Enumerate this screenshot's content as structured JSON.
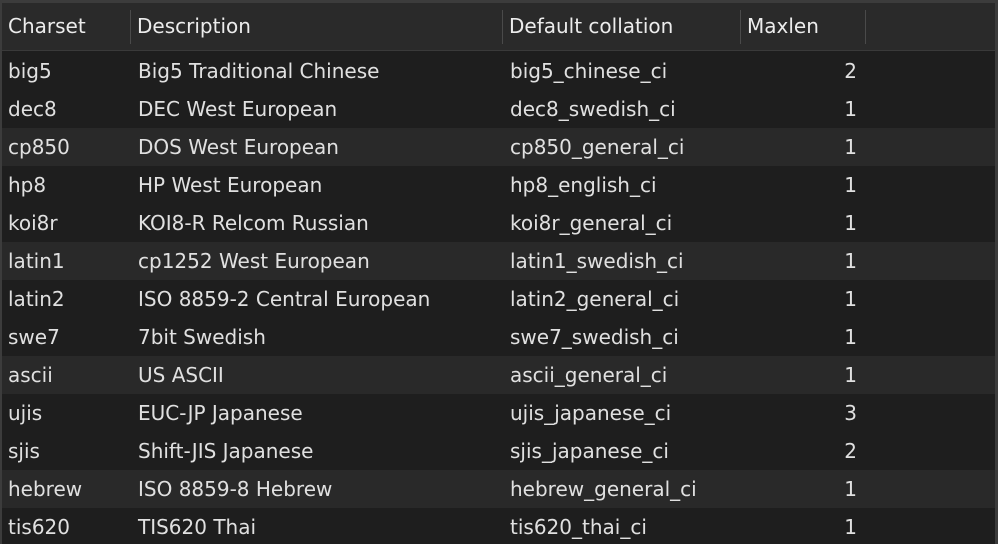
{
  "columns": {
    "charset": "Charset",
    "description": "Description",
    "default_collation": "Default collation",
    "maxlen": "Maxlen"
  },
  "rows": [
    {
      "charset": "big5",
      "description": "Big5 Traditional Chinese",
      "collation": "big5_chinese_ci",
      "maxlen": "2"
    },
    {
      "charset": "dec8",
      "description": "DEC West European",
      "collation": "dec8_swedish_ci",
      "maxlen": "1"
    },
    {
      "charset": "cp850",
      "description": "DOS West European",
      "collation": "cp850_general_ci",
      "maxlen": "1"
    },
    {
      "charset": "hp8",
      "description": "HP West European",
      "collation": "hp8_english_ci",
      "maxlen": "1"
    },
    {
      "charset": "koi8r",
      "description": "KOI8-R Relcom Russian",
      "collation": "koi8r_general_ci",
      "maxlen": "1"
    },
    {
      "charset": "latin1",
      "description": "cp1252 West European",
      "collation": "latin1_swedish_ci",
      "maxlen": "1"
    },
    {
      "charset": "latin2",
      "description": "ISO 8859-2 Central European",
      "collation": "latin2_general_ci",
      "maxlen": "1"
    },
    {
      "charset": "swe7",
      "description": "7bit Swedish",
      "collation": "swe7_swedish_ci",
      "maxlen": "1"
    },
    {
      "charset": "ascii",
      "description": "US ASCII",
      "collation": "ascii_general_ci",
      "maxlen": "1"
    },
    {
      "charset": "ujis",
      "description": "EUC-JP Japanese",
      "collation": "ujis_japanese_ci",
      "maxlen": "3"
    },
    {
      "charset": "sjis",
      "description": "Shift-JIS Japanese",
      "collation": "sjis_japanese_ci",
      "maxlen": "2"
    },
    {
      "charset": "hebrew",
      "description": "ISO 8859-8 Hebrew",
      "collation": "hebrew_general_ci",
      "maxlen": "1"
    },
    {
      "charset": "tis620",
      "description": "TIS620 Thai",
      "collation": "tis620_thai_ci",
      "maxlen": "1"
    }
  ],
  "colors": {
    "background": "#1e1e1e",
    "header_background": "#2a2a2a",
    "alt_row": "#292929",
    "text": "#e0e0e0"
  }
}
